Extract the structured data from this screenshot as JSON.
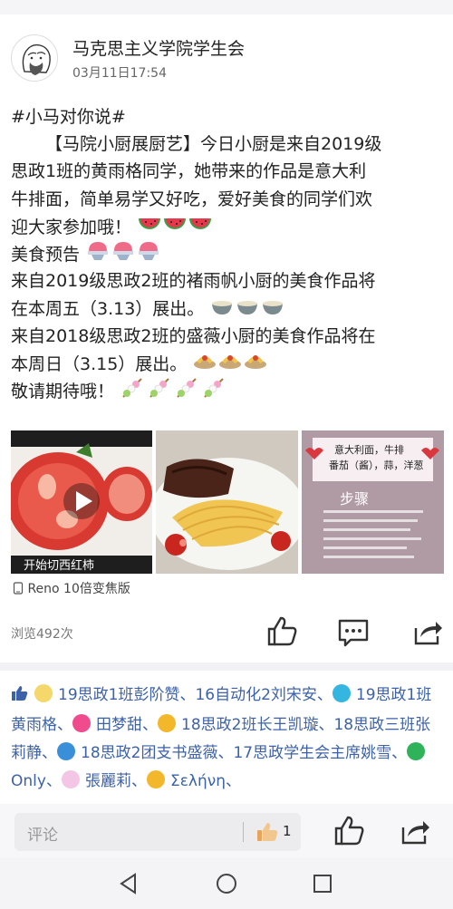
{
  "author": "马克思主义学院学生会",
  "post_time": "03月11日17:54",
  "post": {
    "line1": "#小马对你说#",
    "line2": "【马院小厨展厨艺】今日小厨是来自2019级",
    "line3": "思政1班的黄雨格同学，她带来的作品是意大利",
    "line4": "牛排面，简单易学又好吃，爱好美食的同学们欢",
    "line5": "迎大家参加哦！",
    "line6": "美食预告",
    "line7": "来自2019级思政2班的褚雨帆小厨的美食作品将",
    "line8": "在本周五（3.13）展出。",
    "line9": "来自2018级思政2班的盛薇小厨的美食作品将在",
    "line10": "本周日（3.15）展出。",
    "line11": "敬请期待哦！"
  },
  "photos": {
    "video_caption": "开始切西红柿",
    "card_title_1": "意大利面，牛排",
    "card_title_2": "番茄（酱），蒜，洋葱",
    "card_heading": "步骤"
  },
  "device": "Reno 10倍变焦版",
  "views": "浏览492次",
  "likes": [
    "19思政1班彭阶赞",
    "16自动化2刘宋安",
    "19思政1班黄雨格",
    "田梦甜",
    "18思政2班长王凯璇",
    "18思政三班张莉静",
    "18思政2团支书盛薇",
    "17思政学生会主席姚雪",
    "Only",
    "張麗莉",
    "Σελήνη"
  ],
  "likes_separator": "、",
  "comment_placeholder": "评论",
  "like_count": "1",
  "icons": {
    "like": "thumbs-up-icon",
    "comment": "comment-bubble-icon",
    "share": "share-icon",
    "device": "phone-icon",
    "back": "back-triangle-icon",
    "home": "home-circle-icon",
    "recents": "recents-square-icon"
  },
  "colors": {
    "like_names": "#3d62a8",
    "icon_dark": "#333333"
  }
}
